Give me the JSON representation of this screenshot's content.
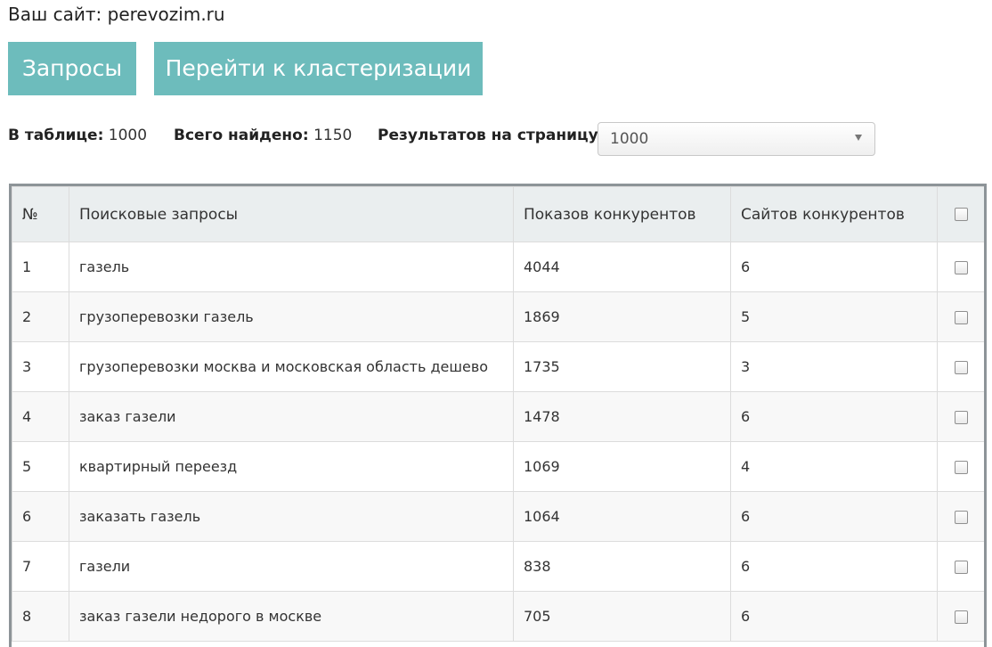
{
  "site": {
    "label": "Ваш сайт: perevozim.ru"
  },
  "buttons": {
    "queries": "Запросы",
    "cluster": "Перейти к кластеризации"
  },
  "stats": {
    "in_table_label": "В таблице:",
    "in_table_value": "1000",
    "found_label": "Всего найдено:",
    "found_value": "1150",
    "per_page_label": "Результатов на страницу:"
  },
  "per_page_select": {
    "value": "1000"
  },
  "table": {
    "headers": {
      "num": "№",
      "query": "Поисковые запросы",
      "impressions": "Показов конкурентов",
      "sites": "Сайтов конкурентов"
    },
    "rows": [
      {
        "num": "1",
        "query": "газель",
        "impressions": "4044",
        "sites": "6"
      },
      {
        "num": "2",
        "query": "грузоперевозки газель",
        "impressions": "1869",
        "sites": "5"
      },
      {
        "num": "3",
        "query": "грузоперевозки москва и московская область дешево",
        "impressions": "1735",
        "sites": "3"
      },
      {
        "num": "4",
        "query": "заказ газели",
        "impressions": "1478",
        "sites": "6"
      },
      {
        "num": "5",
        "query": "квартирный переезд",
        "impressions": "1069",
        "sites": "4"
      },
      {
        "num": "6",
        "query": "заказать газель",
        "impressions": "1064",
        "sites": "6"
      },
      {
        "num": "7",
        "query": "газели",
        "impressions": "838",
        "sites": "6"
      },
      {
        "num": "8",
        "query": "заказ газели недорого в москве",
        "impressions": "705",
        "sites": "6"
      }
    ]
  },
  "colors": {
    "button_bg": "#6dbcbc",
    "header_bg": "#eaeeef",
    "table_border": "#8d9498"
  }
}
